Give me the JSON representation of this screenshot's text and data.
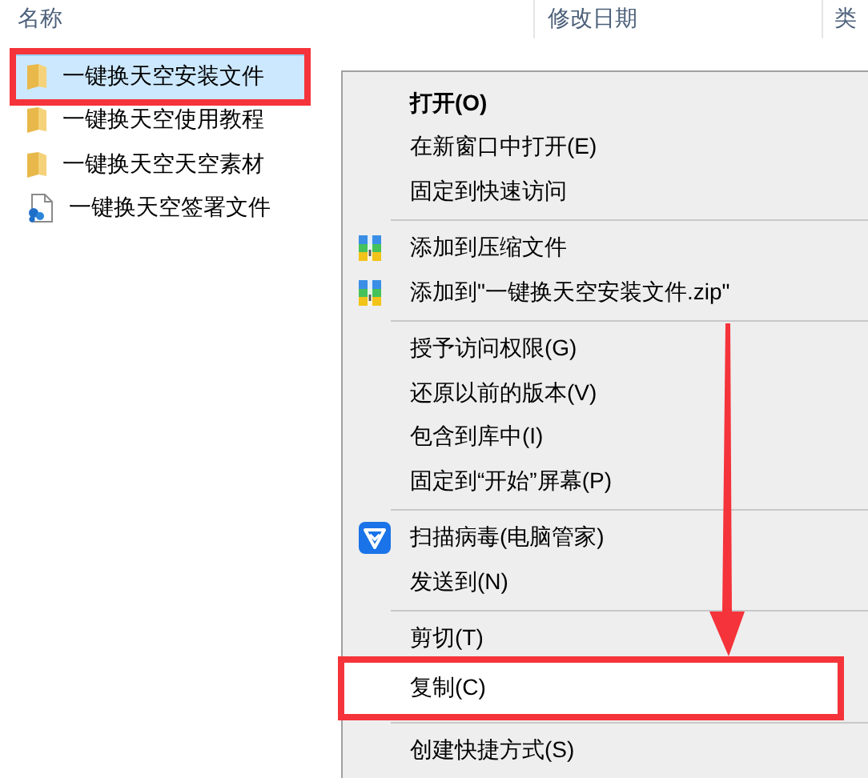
{
  "columns": [
    {
      "label": "名称"
    },
    {
      "label": "修改日期"
    },
    {
      "label": "类"
    }
  ],
  "files": [
    {
      "name": "一键换天空安装文件",
      "kind": "folder",
      "selected": true,
      "annotated": true
    },
    {
      "name": "一键换天空使用教程",
      "kind": "folder",
      "selected": false,
      "annotated": false
    },
    {
      "name": "一键换天空天空素材",
      "kind": "folder",
      "selected": false,
      "annotated": false
    },
    {
      "name": "一键换天空签署文件",
      "kind": "document",
      "selected": false,
      "annotated": false
    }
  ],
  "context_menu": [
    {
      "kind": "default",
      "label": "打开(O)",
      "selected": false,
      "annotated": false
    },
    {
      "kind": "item",
      "label": "在新窗口中打开(E)",
      "selected": false,
      "annotated": false
    },
    {
      "kind": "item",
      "label": "固定到快速访问",
      "selected": false,
      "annotated": false
    },
    {
      "kind": "separator"
    },
    {
      "kind": "archive",
      "label": "添加到压缩文件",
      "selected": false,
      "annotated": false
    },
    {
      "kind": "archive",
      "label": "添加到\"一键换天空安装文件.zip\"",
      "selected": false,
      "annotated": false
    },
    {
      "kind": "separator"
    },
    {
      "kind": "item",
      "label": "授予访问权限(G)",
      "selected": false,
      "annotated": false
    },
    {
      "kind": "item",
      "label": "还原以前的版本(V)",
      "selected": false,
      "annotated": false
    },
    {
      "kind": "item",
      "label": "包含到库中(I)",
      "selected": false,
      "annotated": false
    },
    {
      "kind": "item",
      "label": "固定到“开始”屏幕(P)",
      "selected": false,
      "annotated": false
    },
    {
      "kind": "separator"
    },
    {
      "kind": "antivirus",
      "label": "扫描病毒(电脑管家)",
      "selected": false,
      "annotated": false
    },
    {
      "kind": "item",
      "label": "发送到(N)",
      "selected": false,
      "annotated": false
    },
    {
      "kind": "separator"
    },
    {
      "kind": "item",
      "label": "剪切(T)",
      "selected": false,
      "annotated": false
    },
    {
      "kind": "item",
      "label": "复制(C)",
      "selected": true,
      "annotated": true
    },
    {
      "kind": "separator"
    },
    {
      "kind": "item",
      "label": "创建快捷方式(S)",
      "selected": false,
      "annotated": false
    }
  ]
}
